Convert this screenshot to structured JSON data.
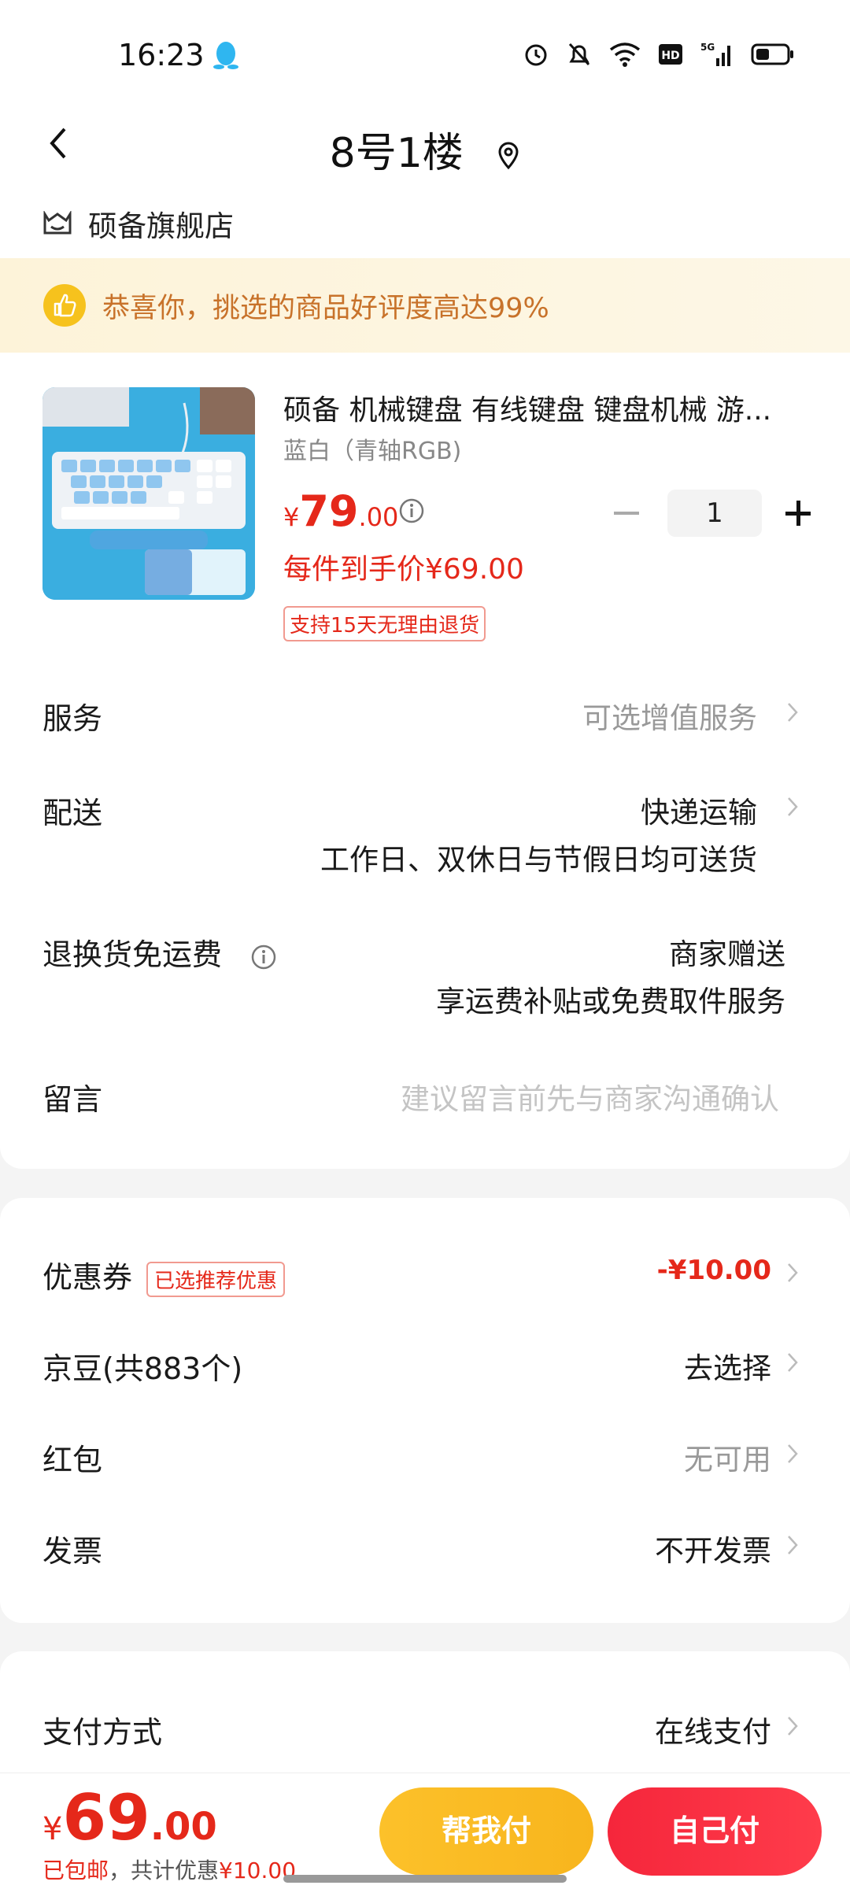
{
  "status_bar": {
    "time": "16:23",
    "icons": [
      "qq-icon",
      "alarm-icon",
      "bell-off-icon",
      "wifi-icon",
      "hd-icon",
      "5g-signal-icon",
      "battery-icon"
    ]
  },
  "header": {
    "title": "8号1楼"
  },
  "store": {
    "name": "硕备旗舰店"
  },
  "praise": {
    "text": "恭喜你，挑选的商品好评度高达99%"
  },
  "product": {
    "title": "硕备 机械键盘 有线键盘 键盘机械 游...",
    "spec": "蓝白（青轴RGB)",
    "price_symbol": "¥",
    "price_int": "79",
    "price_dec": ".00",
    "quantity": "1",
    "per_price": "每件到手价¥69.00",
    "return_tag": "支持15天无理由退货"
  },
  "rows": {
    "service": {
      "label": "服务",
      "value": "可选增值服务"
    },
    "delivery": {
      "label": "配送",
      "value": "快递运输",
      "sub": "工作日、双休日与节假日均可送货"
    },
    "return_ship": {
      "label": "退换货免运费",
      "value": "商家赠送",
      "sub": "享运费补贴或免费取件服务"
    },
    "message": {
      "label": "留言",
      "placeholder": "建议留言前先与商家沟通确认"
    }
  },
  "discounts": {
    "coupon": {
      "label": "优惠券",
      "tag": "已选推荐优惠",
      "value": "-¥10.00"
    },
    "jingdou": {
      "label": "京豆(共883个)",
      "value": "去选择"
    },
    "hongbao": {
      "label": "红包",
      "value": "无可用"
    },
    "invoice": {
      "label": "发票",
      "value": "不开发票"
    }
  },
  "payment": {
    "label": "支付方式",
    "value": "在线支付"
  },
  "bottom": {
    "symbol": "¥",
    "int": "69",
    "dec": ".00",
    "note_free": "已包邮",
    "note_saving": "，共计优惠",
    "note_amount": "¥10.00",
    "help_pay": "帮我付",
    "self_pay": "自己付"
  },
  "colors": {
    "accent_red": "#e5281a",
    "praise_orange": "#c8722a",
    "help_button": "#fcc12a",
    "self_button": "#f5263b"
  }
}
